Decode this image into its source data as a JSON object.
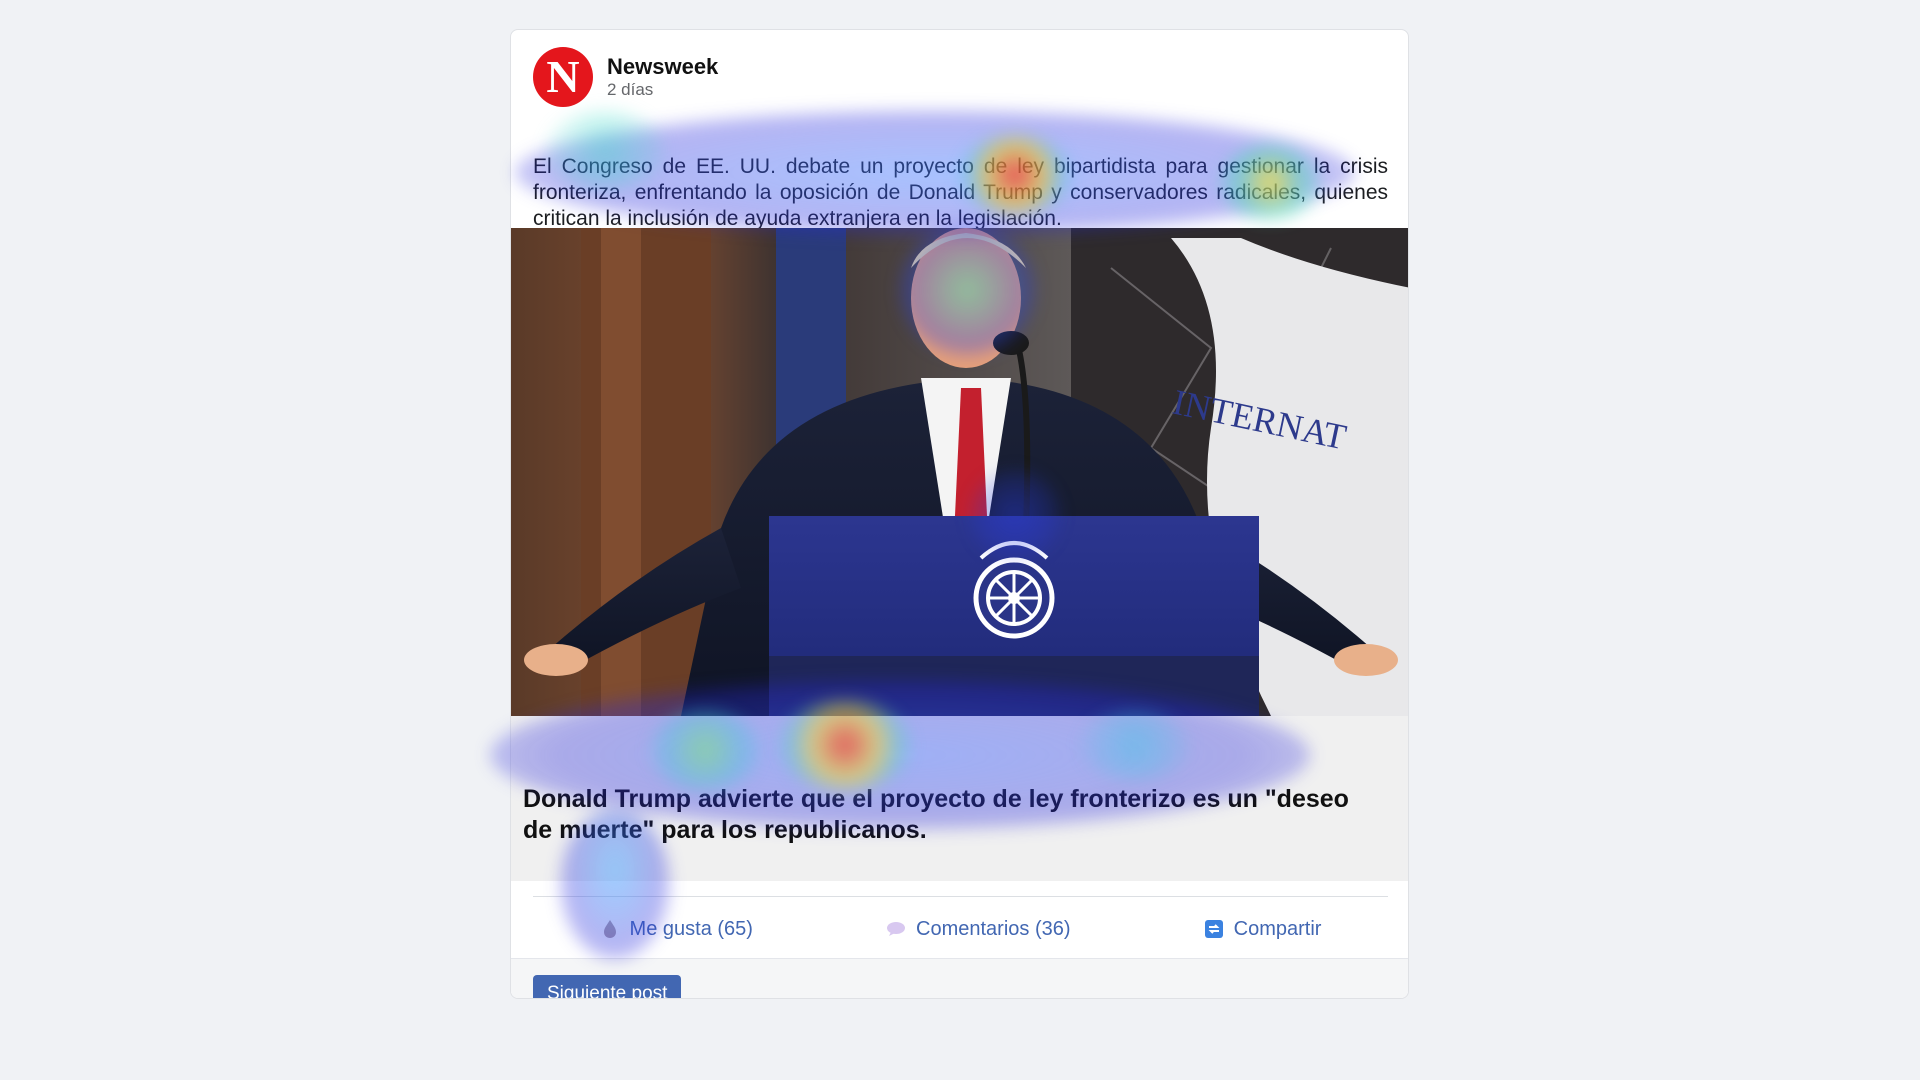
{
  "post": {
    "source_name": "Newsweek",
    "logo_letter": "N",
    "time": "2 días",
    "text": "El Congreso de EE. UU. debate un proyecto de ley bipartidista para gestionar la crisis fronteriza, enfrentando la oposición de Donald Trump y conservadores radicales, quienes critican la inclusión de ayuda extranjera en la legislación.",
    "image_icon": "speaker-at-podium-photo",
    "link_title": "Donald Trump advierte que el proyecto de ley fronterizo es un \"deseo de muerte\" para los republicanos."
  },
  "actions": {
    "like": "Me gusta (65)",
    "comments": "Comentarios (36)",
    "share": "Compartir"
  },
  "footer": {
    "next_label": "Siguiente post"
  },
  "colors": {
    "brand_red": "#e4161c",
    "link_blue": "#4267b2",
    "background": "#f0f2f5"
  },
  "overlay": {
    "type": "attention-heatmap"
  }
}
